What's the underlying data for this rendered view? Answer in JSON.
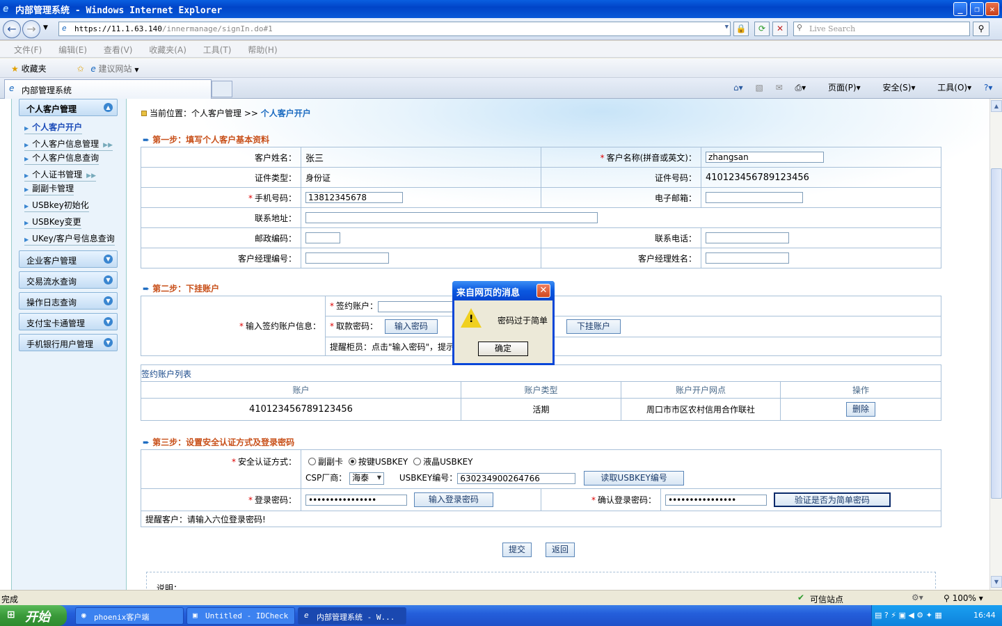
{
  "window": {
    "title": "内部管理系统 - Windows Internet Explorer"
  },
  "browser": {
    "url_host": "https://11.1.63.140",
    "url_path": "/innermanage/signIn.do#1",
    "search_placeholder": "Live Search",
    "menu": [
      "文件(F)",
      "编辑(E)",
      "查看(V)",
      "收藏夹(A)",
      "工具(T)",
      "帮助(H)"
    ],
    "favorites_label": "收藏夹",
    "suggested_sites": "建议网站",
    "tab_title": "内部管理系统",
    "cmd": {
      "page": "页面(P)",
      "safety": "安全(S)",
      "tools": "工具(O)"
    }
  },
  "sidebar": {
    "groups": [
      {
        "label": "个人客户管理"
      },
      {
        "label": "企业客户管理"
      },
      {
        "label": "交易流水查询"
      },
      {
        "label": "操作日志查询"
      },
      {
        "label": "支付宝卡通管理"
      },
      {
        "label": "手机银行用户管理"
      }
    ],
    "items": [
      {
        "label": "个人客户开户"
      },
      {
        "label": "个人客户信息管理"
      },
      {
        "label": "个人客户信息查询"
      },
      {
        "label": "个人证书管理"
      },
      {
        "label": "副副卡管理"
      },
      {
        "label": "USBkey初始化"
      },
      {
        "label": "USBKey变更"
      },
      {
        "label": "UKey/客户号信息查询"
      }
    ]
  },
  "breadcrumb": {
    "prefix": "当前位置：个人客户管理 >>",
    "current": "个人客户开户"
  },
  "step1": {
    "title": "第一步：填写个人客户基本资料",
    "customer_name_label": "客户姓名：",
    "customer_name": "张三",
    "customer_name_en_label": "客户名称(拼音或英文)：",
    "customer_name_en": "zhangsan",
    "id_type_label": "证件类型：",
    "id_type": "身份证",
    "id_number_label": "证件号码：",
    "id_number": "410123456789123456",
    "mobile_label": "手机号码：",
    "mobile": "13812345678",
    "email_label": "电子邮箱：",
    "email": "",
    "address_label": "联系地址：",
    "address": "",
    "postcode_label": "邮政编码：",
    "postcode": "",
    "phone_label": "联系电话：",
    "phone": "",
    "manager_no_label": "客户经理编号：",
    "manager_no": "",
    "manager_name_label": "客户经理姓名：",
    "manager_name": ""
  },
  "step2": {
    "title": "第二步：下挂账户",
    "signing_info_label": "输入签约账户信息：",
    "signing_account_label": "签约账户：",
    "withdraw_pwd_label": "取款密码：",
    "input_pwd_button": "输入密码",
    "attach_button": "下挂账户",
    "reminder": "提醒柜员：点击\"输入密码\"，提示",
    "list_title": "签约账户列表",
    "columns": [
      "账户",
      "账户类型",
      "账户开户网点",
      "操作"
    ],
    "rows": [
      {
        "account": "410123456789123456",
        "type": "活期",
        "branch": "周口市市区农村信用合作联社",
        "action": "删除"
      }
    ]
  },
  "step3": {
    "title": "第三步：设置安全认证方式及登录密码",
    "auth_label": "安全认证方式：",
    "auth_options": [
      "副副卡",
      "按键USBKEY",
      "液晶USBKEY"
    ],
    "csp_label": "CSP厂商：",
    "csp_value": "海泰",
    "usbkey_no_label": "USBKEY编号：",
    "usbkey_no": "630234900264766",
    "read_usbkey_button": "读取USBKEY编号",
    "login_pwd_label": "登录密码：",
    "login_pwd": "••••••••••••••••",
    "input_login_pwd_button": "输入登录密码",
    "confirm_pwd_label": "确认登录密码：",
    "confirm_pwd": "••••••••••••••••",
    "verify_button": "验证是否为简单密码",
    "reminder": "提醒客户：请输入六位登录密码!"
  },
  "actions": {
    "submit": "提交",
    "back": "返回",
    "note": "说明："
  },
  "dialog": {
    "title": "来自网页的消息",
    "message": "密码过于简单",
    "ok": "确定"
  },
  "status": {
    "text": "完成",
    "trusted": "可信站点",
    "zoom": "100%"
  },
  "taskbar": {
    "start": "开始",
    "tasks": [
      "phoenix客户端",
      "Untitled - IDCheck",
      "内部管理系统 - W..."
    ],
    "clock": "16:44"
  }
}
